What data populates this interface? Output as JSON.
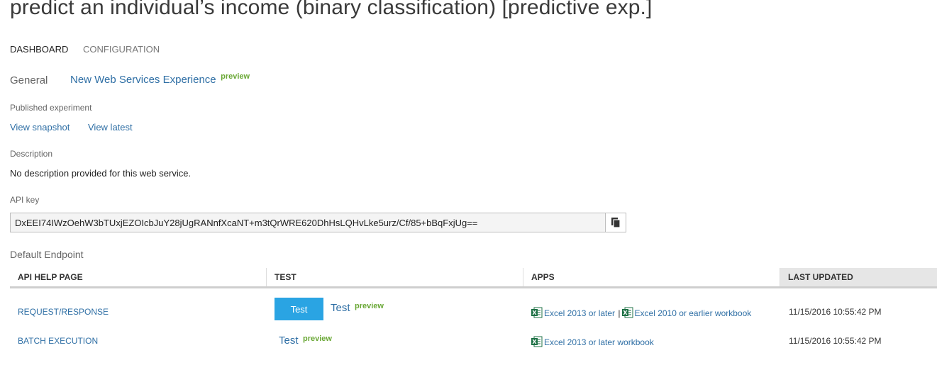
{
  "page": {
    "title": "predict an individual’s income (binary classification) [predictive exp.]"
  },
  "tabs": [
    {
      "label": "DASHBOARD"
    },
    {
      "label": "CONFIGURATION"
    }
  ],
  "general": {
    "label": "General",
    "link": "New Web Services Experience",
    "badge": "preview"
  },
  "published": {
    "label": "Published experiment",
    "view_snapshot": "View snapshot",
    "view_latest": "View latest"
  },
  "description": {
    "label": "Description",
    "text": "No description provided for this web service."
  },
  "api_key": {
    "label": "API key",
    "value": "DxEEI74IWzOehW3bTUxjEZOIcbJuY28jUgRANnfXcaNT+m3tQrWRE620DhHsLQHvLke5urz/Cf/85+bBqFxjUg=="
  },
  "endpoint": {
    "label": "Default Endpoint",
    "columns": [
      "API HELP PAGE",
      "TEST",
      "APPS",
      "LAST UPDATED"
    ],
    "rows": [
      {
        "api": "REQUEST/RESPONSE",
        "test_button": "Test",
        "test_link": "Test",
        "test_badge": "preview",
        "app1": "Excel 2013 or later",
        "separator": "|",
        "app2": "Excel 2010 or earlier workbook",
        "updated": "11/15/2016 10:55:42 PM"
      },
      {
        "api": "BATCH EXECUTION",
        "test_link": "Test",
        "test_badge": "preview",
        "app1": "Excel 2013 or later workbook",
        "updated": "11/15/2016 10:55:42 PM"
      }
    ]
  },
  "colors": {
    "link": "#2f6fa5",
    "preview": "#6aa836",
    "button": "#2aa4e3",
    "excel": "#1e7145"
  }
}
